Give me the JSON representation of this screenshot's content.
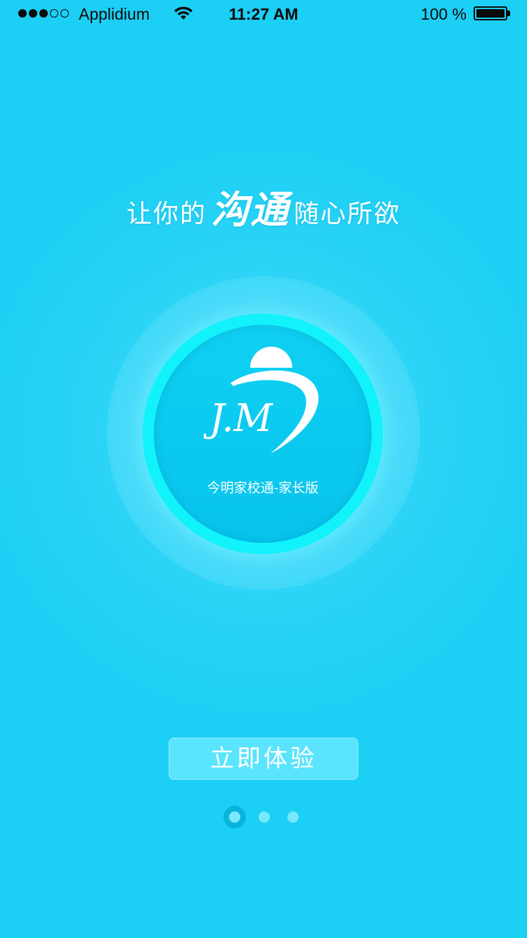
{
  "status_bar": {
    "carrier": "Applidium",
    "time": "11:27 AM",
    "battery_percent": "100 %",
    "signal_bars": 3,
    "signal_total": 5,
    "wifi_icon": "wifi-icon",
    "battery_level": 1.0
  },
  "slogan": {
    "before": "让你的",
    "emphasis": "沟通",
    "after": "随心所欲"
  },
  "logo": {
    "monogram": "J.M",
    "app_name": "今明家校通-家长版"
  },
  "cta": {
    "label": "立即体验"
  },
  "pager": {
    "count": 3,
    "active_index": 0
  },
  "colors": {
    "background": "#1ccff4",
    "ring": "#12f2fb",
    "inner_circle": "#08c4ec",
    "button": "#5be4fd",
    "active_dot": "#0ab3d9",
    "dot": "#7ae8fc"
  }
}
